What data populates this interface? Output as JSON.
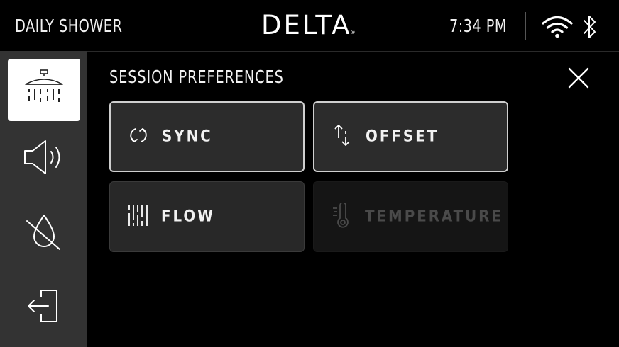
{
  "header": {
    "title": "DAILY SHOWER",
    "brand": "DELTA",
    "brand_mark": "®",
    "time": "7:34 PM",
    "icons": [
      "wifi-icon",
      "bluetooth-icon"
    ]
  },
  "sidebar": {
    "items": [
      {
        "name": "shower-head",
        "icon": "shower-head-icon",
        "active": true
      },
      {
        "name": "speaker",
        "icon": "speaker-icon",
        "active": false
      },
      {
        "name": "water-off",
        "icon": "water-off-icon",
        "active": false
      },
      {
        "name": "exit",
        "icon": "exit-icon",
        "active": false
      }
    ]
  },
  "panel": {
    "title": "SESSION PREFERENCES",
    "close_icon": "close-icon",
    "buttons": [
      {
        "label": "SYNC",
        "icon": "sync-icon",
        "state": "selected"
      },
      {
        "label": "OFFSET",
        "icon": "offset-arrows-icon",
        "state": "selected"
      },
      {
        "label": "FLOW",
        "icon": "flow-icon",
        "state": "enabled"
      },
      {
        "label": "TEMPERATURE",
        "icon": "thermometer-icon",
        "state": "disabled"
      }
    ]
  },
  "colors": {
    "background": "#000000",
    "sidebar": "#333333",
    "button": "#2c2c2c",
    "selected_border": "#cfcfcf",
    "disabled_text": "#4a4a4a"
  }
}
